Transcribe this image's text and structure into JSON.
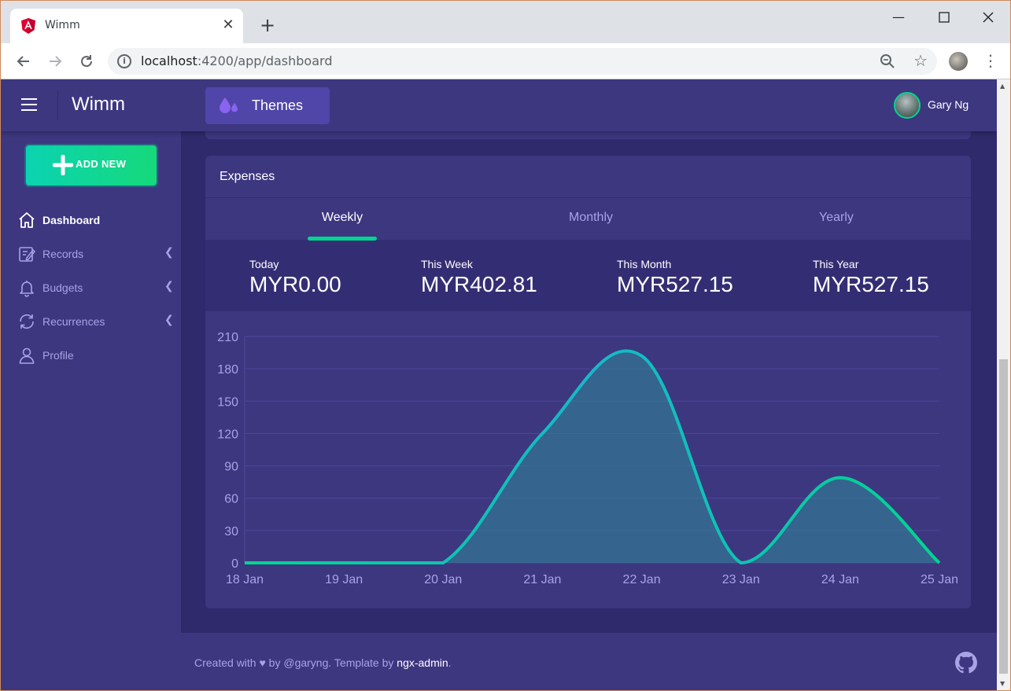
{
  "browser": {
    "tab_title": "Wimm",
    "url_host": "localhost",
    "url_rest": ":4200/app/dashboard",
    "new_tab": "+",
    "close_tab": "✕"
  },
  "header": {
    "brand": "Wimm",
    "themes_label": "Themes",
    "user_name": "Gary Ng"
  },
  "sidebar": {
    "add_new_label": "ADD NEW",
    "items": [
      {
        "label": "Dashboard",
        "icon": "home-icon",
        "active": true
      },
      {
        "label": "Records",
        "icon": "edit-icon",
        "expandable": true
      },
      {
        "label": "Budgets",
        "icon": "bell-icon",
        "expandable": true
      },
      {
        "label": "Recurrences",
        "icon": "refresh-icon",
        "expandable": true
      },
      {
        "label": "Profile",
        "icon": "person-icon"
      }
    ]
  },
  "expenses": {
    "title": "Expenses",
    "tabs": [
      "Weekly",
      "Monthly",
      "Yearly"
    ],
    "active_tab": "Weekly",
    "summary": [
      {
        "label": "Today",
        "value": "MYR0.00"
      },
      {
        "label": "This Week",
        "value": "MYR402.81"
      },
      {
        "label": "This Month",
        "value": "MYR527.15"
      },
      {
        "label": "This Year",
        "value": "MYR527.15"
      }
    ]
  },
  "chart_data": {
    "type": "area",
    "x": [
      "18 Jan",
      "19 Jan",
      "20 Jan",
      "21 Jan",
      "22 Jan",
      "23 Jan",
      "24 Jan",
      "25 Jan"
    ],
    "values": [
      0,
      0,
      0,
      120,
      192,
      0,
      79,
      0
    ],
    "yticks": [
      0,
      30,
      60,
      90,
      120,
      150,
      180,
      210
    ],
    "ylim": [
      0,
      210
    ],
    "grid": true,
    "colors": {
      "line_start": "#00d68f",
      "line_mid": "#17b8c8",
      "fill": "#2f8a9a"
    }
  },
  "footer": {
    "prefix": "Created with ♥ by @garyng. Template by ",
    "link": "ngx-admin",
    "suffix": "."
  },
  "colors": {
    "accent": "#00d68f",
    "header_bg": "#3d3780",
    "page_bg": "#2f2a6b",
    "muted_text": "#a9a2e6"
  }
}
